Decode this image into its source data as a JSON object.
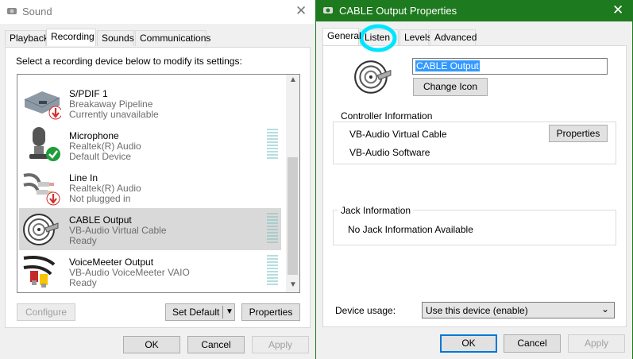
{
  "sound_window": {
    "title": "Sound",
    "tabs": [
      {
        "label": "Playback"
      },
      {
        "label": "Recording"
      },
      {
        "label": "Sounds"
      },
      {
        "label": "Communications"
      }
    ],
    "instruction": "Select a recording device below to modify its settings:",
    "devices": [
      {
        "name": "S/PDIF 1",
        "line1": "Breakaway Pipeline",
        "line2": "Currently unavailable",
        "icon": "spdif-icon",
        "badge": "down-arrow-red"
      },
      {
        "name": "Microphone",
        "line1": "Realtek(R) Audio",
        "line2": "Default Device",
        "icon": "microphone-icon",
        "badge": "check-green"
      },
      {
        "name": "Line In",
        "line1": "Realtek(R) Audio",
        "line2": "Not plugged in",
        "icon": "line-in-cable-icon",
        "badge": "down-arrow-red"
      },
      {
        "name": "CABLE Output",
        "line1": "VB-Audio Virtual Cable",
        "line2": "Ready",
        "icon": "cable-reel-icon",
        "badge": ""
      },
      {
        "name": "VoiceMeeter Output",
        "line1": "VB-Audio VoiceMeeter VAIO",
        "line2": "Ready",
        "icon": "rca-cable-icon",
        "badge": ""
      }
    ],
    "buttons": {
      "configure": "Configure",
      "set_default": "Set Default",
      "properties": "Properties",
      "ok": "OK",
      "cancel": "Cancel",
      "apply": "Apply"
    }
  },
  "props_window": {
    "title": "CABLE Output Properties",
    "tabs": [
      {
        "label": "General"
      },
      {
        "label": "Listen"
      },
      {
        "label": "Levels"
      },
      {
        "label": "Advanced"
      }
    ],
    "name_field_value": "CABLE Output",
    "change_icon_label": "Change Icon",
    "controller": {
      "title": "Controller Information",
      "name": "VB-Audio Virtual Cable",
      "vendor": "VB-Audio Software",
      "properties_label": "Properties"
    },
    "jack": {
      "title": "Jack Information",
      "text": "No Jack Information Available"
    },
    "device_usage_label": "Device usage:",
    "device_usage_value": "Use this device (enable)",
    "buttons": {
      "ok": "OK",
      "cancel": "Cancel",
      "apply": "Apply"
    },
    "colors": {
      "titlebar": "#1e7a1e",
      "highlight_circle": "#00e5ff",
      "selection": "#3399ff"
    }
  }
}
